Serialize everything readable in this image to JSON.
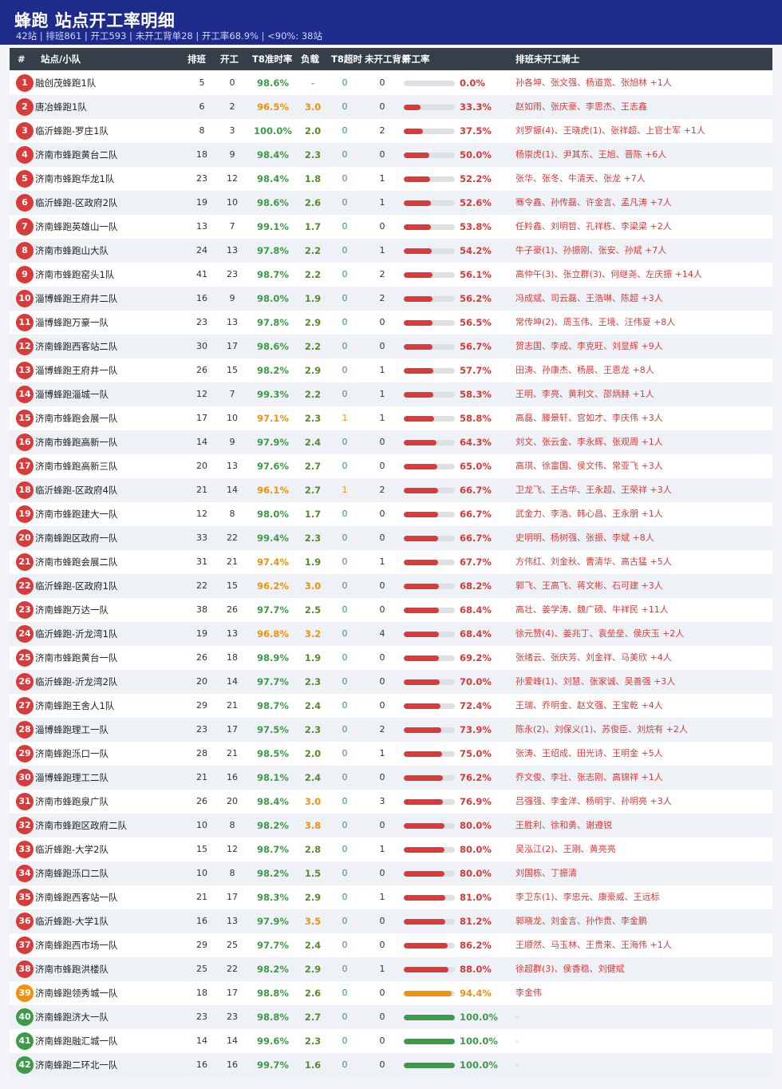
{
  "header": {
    "title": "蜂跑  站点开工率明细",
    "summary": "42站 | 排班861 | 开工593 | 未开工背单28 | 开工率68.9% | <90%: 38站"
  },
  "columns": {
    "num": "#",
    "station": "站点/小队",
    "scheduled": "排班",
    "working": "开工",
    "t8_rate": "T8准时率",
    "load": "负载",
    "t8_overtime": "T8超时",
    "not_working_backlog": "未开工背单",
    "work_rate": "开工率",
    "riders": "排班未开工骑士"
  },
  "colors": {
    "header_bg": "#1e2a8c",
    "table_header_bg": "#343f4a",
    "red": "#d93b3b",
    "orange": "#f0920f",
    "green": "#3d9a48"
  },
  "rows": [
    {
      "idx": "1",
      "name": "融创茂蜂跑1队",
      "sched": "5",
      "work": "0",
      "rate": "98.6%",
      "load": "-",
      "ot": "0",
      "back": "0",
      "pct": "0.0%",
      "riders": "孙各坤、张文强、杨道宽、张旭林 +1人"
    },
    {
      "idx": "2",
      "name": "唐冶蜂跑1队",
      "sched": "6",
      "work": "2",
      "rate": "96.5%",
      "load": "3.0",
      "ot": "0",
      "back": "0",
      "pct": "33.3%",
      "riders": "赵如雨、张庆豪、李思杰、王志鑫"
    },
    {
      "idx": "3",
      "name": "临沂蜂跑-罗庄1队",
      "sched": "8",
      "work": "3",
      "rate": "100.0%",
      "load": "2.0",
      "ot": "0",
      "back": "2",
      "pct": "37.5%",
      "riders": "刘罗振(4)、王晓虎(1)、张祥超、上官士军 +1人"
    },
    {
      "idx": "4",
      "name": "济南市蜂跑黄台二队",
      "sched": "18",
      "work": "9",
      "rate": "98.4%",
      "load": "2.3",
      "ot": "0",
      "back": "0",
      "pct": "50.0%",
      "riders": "杨崇虎(1)、尹其东、王旭、晋陈 +6人"
    },
    {
      "idx": "5",
      "name": "济南市蜂跑华龙1队",
      "sched": "23",
      "work": "12",
      "rate": "98.4%",
      "load": "1.8",
      "ot": "0",
      "back": "1",
      "pct": "52.2%",
      "riders": "张华、张冬、牛清天、张龙 +7人"
    },
    {
      "idx": "6",
      "name": "临沂蜂跑-区政府2队",
      "sched": "19",
      "work": "10",
      "rate": "98.6%",
      "load": "2.6",
      "ot": "0",
      "back": "1",
      "pct": "52.6%",
      "riders": "骞令鑫、孙传磊、许金言、孟凡涛 +7人"
    },
    {
      "idx": "7",
      "name": "济南蜂跑英雄山一队",
      "sched": "13",
      "work": "7",
      "rate": "99.1%",
      "load": "1.7",
      "ot": "0",
      "back": "0",
      "pct": "53.8%",
      "riders": "任羚鑫、刘明哲、孔祥栋、李梁梁 +2人"
    },
    {
      "idx": "8",
      "name": "济南市蜂跑山大队",
      "sched": "24",
      "work": "13",
      "rate": "97.8%",
      "load": "2.2",
      "ot": "0",
      "back": "1",
      "pct": "54.2%",
      "riders": "牛子豪(1)、孙振刚、张安、孙斌 +7人"
    },
    {
      "idx": "9",
      "name": "济南市蜂跑窑头1队",
      "sched": "41",
      "work": "23",
      "rate": "98.7%",
      "load": "2.2",
      "ot": "0",
      "back": "2",
      "pct": "56.1%",
      "riders": "高仲午(3)、张立群(3)、何继尧、左庆振 +14人"
    },
    {
      "idx": "10",
      "name": "淄博蜂跑王府井二队",
      "sched": "16",
      "work": "9",
      "rate": "98.0%",
      "load": "1.9",
      "ot": "0",
      "back": "2",
      "pct": "56.2%",
      "riders": "冯成斌、司云磊、王浩琳、陈超 +3人"
    },
    {
      "idx": "11",
      "name": "淄博蜂跑万豪一队",
      "sched": "23",
      "work": "13",
      "rate": "97.8%",
      "load": "2.9",
      "ot": "0",
      "back": "0",
      "pct": "56.5%",
      "riders": "常传坤(2)、周玉伟、王境、汪伟夏 +8人"
    },
    {
      "idx": "12",
      "name": "济南蜂跑西客站二队",
      "sched": "30",
      "work": "17",
      "rate": "98.6%",
      "load": "2.2",
      "ot": "0",
      "back": "0",
      "pct": "56.7%",
      "riders": "贺志国、李成、李克旺、刘显辉 +9人"
    },
    {
      "idx": "13",
      "name": "淄博蜂跑王府井一队",
      "sched": "26",
      "work": "15",
      "rate": "98.2%",
      "load": "2.9",
      "ot": "0",
      "back": "1",
      "pct": "57.7%",
      "riders": "田涛、孙康杰、杨晨、王恩龙 +8人"
    },
    {
      "idx": "14",
      "name": "淄博蜂跑淄城一队",
      "sched": "12",
      "work": "7",
      "rate": "99.3%",
      "load": "2.2",
      "ot": "0",
      "back": "1",
      "pct": "58.3%",
      "riders": "王明、李亮、黄利文、邵炳赫 +1人"
    },
    {
      "idx": "15",
      "name": "济南市蜂跑会展一队",
      "sched": "17",
      "work": "10",
      "rate": "97.1%",
      "load": "2.3",
      "ot": "1",
      "back": "1",
      "pct": "58.8%",
      "riders": "高磊、滕景轩、宫如才、李庆伟 +3人"
    },
    {
      "idx": "16",
      "name": "济南市蜂跑高新一队",
      "sched": "14",
      "work": "9",
      "rate": "97.9%",
      "load": "2.4",
      "ot": "0",
      "back": "0",
      "pct": "64.3%",
      "riders": "刘文、张云金、李永辉、张观周 +1人"
    },
    {
      "idx": "17",
      "name": "济南市蜂跑高新三队",
      "sched": "20",
      "work": "13",
      "rate": "97.6%",
      "load": "2.7",
      "ot": "0",
      "back": "0",
      "pct": "65.0%",
      "riders": "高琪、徐富国、侯文伟、常亚飞 +3人"
    },
    {
      "idx": "18",
      "name": "临沂蜂跑-区政府4队",
      "sched": "21",
      "work": "14",
      "rate": "96.1%",
      "load": "2.7",
      "ot": "1",
      "back": "2",
      "pct": "66.7%",
      "riders": "卫龙飞、王占华、王永超、王荣祥 +3人"
    },
    {
      "idx": "19",
      "name": "济南市蜂跑建大一队",
      "sched": "12",
      "work": "8",
      "rate": "98.0%",
      "load": "1.7",
      "ot": "0",
      "back": "0",
      "pct": "66.7%",
      "riders": "武金力、李浩、韩心昌、王永朋 +1人"
    },
    {
      "idx": "20",
      "name": "济南蜂跑区政府一队",
      "sched": "33",
      "work": "22",
      "rate": "99.4%",
      "load": "2.3",
      "ot": "0",
      "back": "0",
      "pct": "66.7%",
      "riders": "史明明、杨树强、张振、李斌 +8人"
    },
    {
      "idx": "21",
      "name": "济南市蜂跑会展二队",
      "sched": "31",
      "work": "21",
      "rate": "97.4%",
      "load": "1.9",
      "ot": "0",
      "back": "1",
      "pct": "67.7%",
      "riders": "方伟红、刘金秋、曹清华、高古猛 +5人"
    },
    {
      "idx": "22",
      "name": "临沂蜂跑-区政府1队",
      "sched": "22",
      "work": "15",
      "rate": "96.2%",
      "load": "3.0",
      "ot": "0",
      "back": "0",
      "pct": "68.2%",
      "riders": "郭飞、王高飞、蒋文彬、石可建 +3人"
    },
    {
      "idx": "23",
      "name": "济南蜂跑万达一队",
      "sched": "38",
      "work": "26",
      "rate": "97.7%",
      "load": "2.5",
      "ot": "0",
      "back": "0",
      "pct": "68.4%",
      "riders": "高壮、姜学涛、魏广硕、牛祥民 +11人"
    },
    {
      "idx": "24",
      "name": "临沂蜂跑-沂龙湾1队",
      "sched": "19",
      "work": "13",
      "rate": "96.8%",
      "load": "3.2",
      "ot": "0",
      "back": "4",
      "pct": "68.4%",
      "riders": "徐元赞(4)、姜兆丁、袁垒垒、侯庆玉 +2人"
    },
    {
      "idx": "25",
      "name": "济南市蜂跑黄台一队",
      "sched": "26",
      "work": "18",
      "rate": "98.9%",
      "load": "1.9",
      "ot": "0",
      "back": "0",
      "pct": "69.2%",
      "riders": "张绪云、张庆芳、刘金祥、马美欣 +4人"
    },
    {
      "idx": "26",
      "name": "临沂蜂跑-沂龙湾2队",
      "sched": "20",
      "work": "14",
      "rate": "97.7%",
      "load": "2.3",
      "ot": "0",
      "back": "0",
      "pct": "70.0%",
      "riders": "孙爱峰(1)、刘慧、张家诚、吴善强 +3人"
    },
    {
      "idx": "27",
      "name": "济南蜂跑王舍人1队",
      "sched": "29",
      "work": "21",
      "rate": "98.7%",
      "load": "2.4",
      "ot": "0",
      "back": "0",
      "pct": "72.4%",
      "riders": "王瑞、乔明金、赵文强、王宝乾 +4人"
    },
    {
      "idx": "28",
      "name": "淄博蜂跑理工一队",
      "sched": "23",
      "work": "17",
      "rate": "97.5%",
      "load": "2.3",
      "ot": "0",
      "back": "2",
      "pct": "73.9%",
      "riders": "陈永(2)、刘保义(1)、苏俊臣、刘烷有 +2人"
    },
    {
      "idx": "29",
      "name": "济南蜂跑泺口一队",
      "sched": "28",
      "work": "21",
      "rate": "98.5%",
      "load": "2.0",
      "ot": "0",
      "back": "1",
      "pct": "75.0%",
      "riders": "张涛、王绍成、田光诗、王明金 +5人"
    },
    {
      "idx": "30",
      "name": "淄博蜂跑理工二队",
      "sched": "21",
      "work": "16",
      "rate": "98.1%",
      "load": "2.4",
      "ot": "0",
      "back": "0",
      "pct": "76.2%",
      "riders": "乔文俊、李壮、张志刚、高锦祥 +1人"
    },
    {
      "idx": "31",
      "name": "济南市蜂跑泉广队",
      "sched": "26",
      "work": "20",
      "rate": "98.4%",
      "load": "3.0",
      "ot": "0",
      "back": "3",
      "pct": "76.9%",
      "riders": "吕强强、李金洋、杨明宇、孙明亮 +3人"
    },
    {
      "idx": "32",
      "name": "济南市蜂跑区政府二队",
      "sched": "10",
      "work": "8",
      "rate": "98.2%",
      "load": "3.8",
      "ot": "0",
      "back": "0",
      "pct": "80.0%",
      "riders": "王胜利、徐和勇、谢遵锐"
    },
    {
      "idx": "33",
      "name": "临沂蜂跑-大学2队",
      "sched": "15",
      "work": "12",
      "rate": "98.7%",
      "load": "2.8",
      "ot": "0",
      "back": "1",
      "pct": "80.0%",
      "riders": "吴泓江(2)、王刚、黄亮亮"
    },
    {
      "idx": "34",
      "name": "济南蜂跑泺口二队",
      "sched": "10",
      "work": "8",
      "rate": "98.2%",
      "load": "1.5",
      "ot": "0",
      "back": "0",
      "pct": "80.0%",
      "riders": "刘国栋、丁振清"
    },
    {
      "idx": "35",
      "name": "济南蜂跑西客站一队",
      "sched": "21",
      "work": "17",
      "rate": "98.3%",
      "load": "2.9",
      "ot": "0",
      "back": "1",
      "pct": "81.0%",
      "riders": "李卫东(1)、李忠元、康豪威、王远标"
    },
    {
      "idx": "36",
      "name": "临沂蜂跑-大学1队",
      "sched": "16",
      "work": "13",
      "rate": "97.9%",
      "load": "3.5",
      "ot": "0",
      "back": "0",
      "pct": "81.2%",
      "riders": "郭晓龙、刘金言、孙作贵、李金鹏"
    },
    {
      "idx": "37",
      "name": "济南蜂跑西市场一队",
      "sched": "29",
      "work": "25",
      "rate": "97.7%",
      "load": "2.4",
      "ot": "0",
      "back": "0",
      "pct": "86.2%",
      "riders": "王顺然、马玉林、王贵来、王海伟 +1人"
    },
    {
      "idx": "38",
      "name": "济南市蜂跑洪楼队",
      "sched": "25",
      "work": "22",
      "rate": "98.2%",
      "load": "2.9",
      "ot": "0",
      "back": "1",
      "pct": "88.0%",
      "riders": "徐超群(3)、侯香稳、刘健斌"
    },
    {
      "idx": "39",
      "name": "济南蜂跑领秀城一队",
      "sched": "18",
      "work": "17",
      "rate": "98.8%",
      "load": "2.6",
      "ot": "0",
      "back": "0",
      "pct": "94.4%",
      "riders": "李金伟"
    },
    {
      "idx": "40",
      "name": "济南蜂跑济大一队",
      "sched": "23",
      "work": "23",
      "rate": "98.8%",
      "load": "2.7",
      "ot": "0",
      "back": "0",
      "pct": "100.0%",
      "riders": "-"
    },
    {
      "idx": "41",
      "name": "济南蜂跑融汇城一队",
      "sched": "14",
      "work": "14",
      "rate": "99.6%",
      "load": "2.3",
      "ot": "0",
      "back": "0",
      "pct": "100.0%",
      "riders": "-"
    },
    {
      "idx": "42",
      "name": "济南蜂跑二环北一队",
      "sched": "16",
      "work": "16",
      "rate": "99.7%",
      "load": "1.6",
      "ot": "0",
      "back": "0",
      "pct": "100.0%",
      "riders": "-"
    }
  ]
}
